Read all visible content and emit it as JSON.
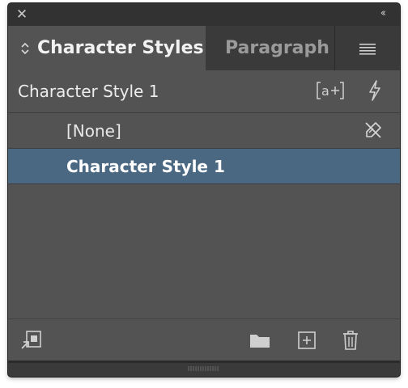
{
  "titlebar": {
    "close_icon": "close-icon",
    "collapse_icon": "double-chevron-left-icon"
  },
  "tabs": [
    {
      "label": "Character Styles",
      "active": true
    },
    {
      "label": "Paragraph Styles",
      "active": false
    }
  ],
  "header": {
    "current_style": "Character Style 1",
    "icons": [
      "create-style-from-selection-icon",
      "quick-apply-icon"
    ]
  },
  "styles": [
    {
      "label": "[None]",
      "selected": false,
      "icon": "pencil-crossed-icon"
    },
    {
      "label": "Character Style 1",
      "selected": true
    }
  ],
  "footer": {
    "icons": [
      "load-styles-icon",
      "folder-icon",
      "new-style-icon",
      "trash-icon"
    ]
  },
  "colors": {
    "panel": "#535353",
    "selected_row": "#4b6883",
    "tabbar": "#3a3a3a"
  }
}
